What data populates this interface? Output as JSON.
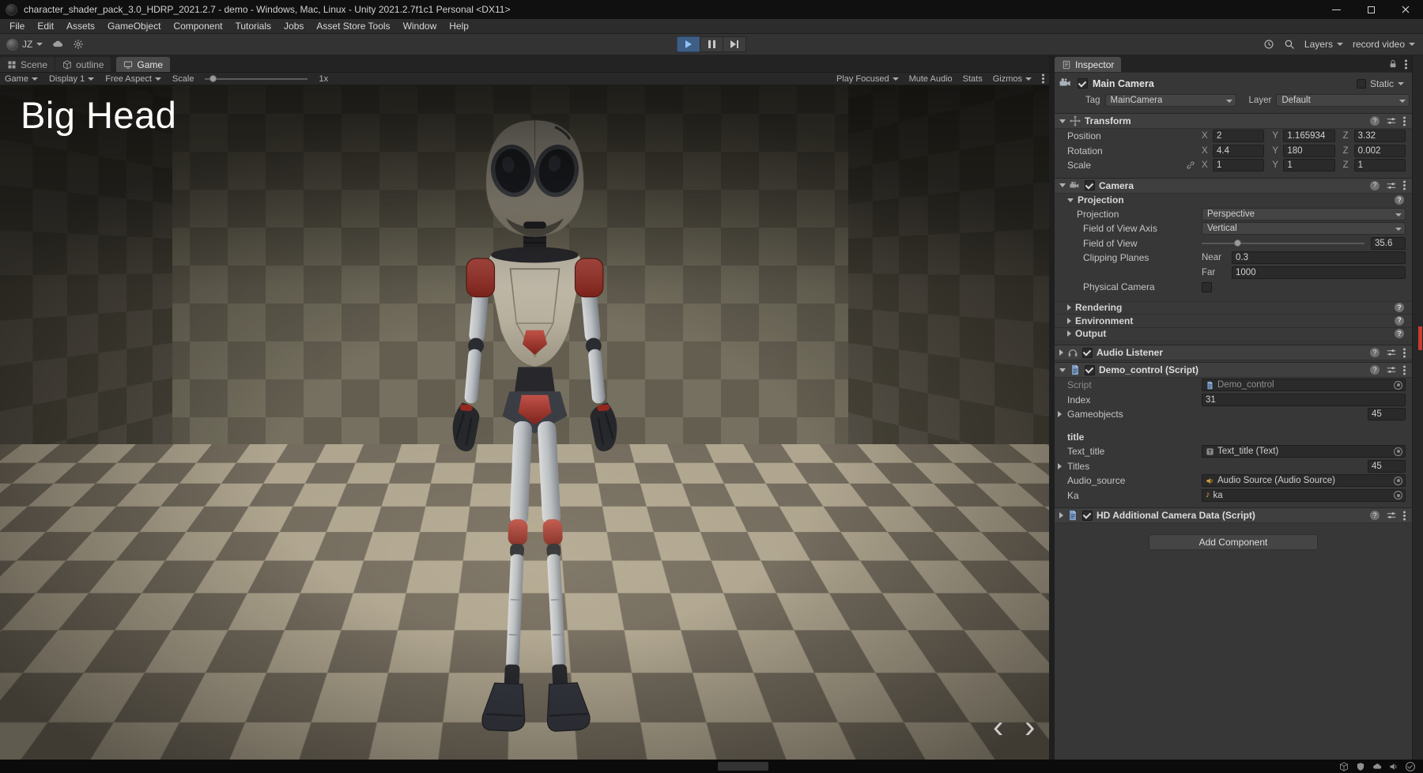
{
  "title_bar": {
    "title": "character_shader_pack_3.0_HDRP_2021.2.7 - demo - Windows, Mac, Linux - Unity 2021.2.7f1c1 Personal <DX11>"
  },
  "menu": {
    "file": "File",
    "edit": "Edit",
    "assets": "Assets",
    "gameobject": "GameObject",
    "component": "Component",
    "tutorials": "Tutorials",
    "jobs": "Jobs",
    "asset_store_tools": "Asset Store Tools",
    "window": "Window",
    "help": "Help"
  },
  "toolbar": {
    "account": "JZ",
    "layers": "Layers",
    "layout": "record video"
  },
  "tabs": {
    "scene": "Scene",
    "outline": "outline",
    "game": "Game",
    "inspector": "Inspector"
  },
  "game_toolbar": {
    "target": "Game",
    "display": "Display 1",
    "aspect": "Free Aspect",
    "scale_label": "Scale",
    "scale_value": "1x",
    "play_focused": "Play Focused",
    "mute": "Mute Audio",
    "stats": "Stats",
    "gizmos": "Gizmos"
  },
  "game_view": {
    "overlay_title": "Big Head",
    "prev": "‹",
    "next": "›"
  },
  "inspector": {
    "header": {
      "name": "Main Camera",
      "static": "Static",
      "tag_label": "Tag",
      "tag": "MainCamera",
      "layer_label": "Layer",
      "layer": "Default"
    },
    "transform": {
      "title": "Transform",
      "axis": {
        "x": "X",
        "y": "Y",
        "z": "Z"
      },
      "position": {
        "label": "Position",
        "x": "2",
        "y": "1.165934",
        "z": "3.32"
      },
      "rotation": {
        "label": "Rotation",
        "x": "4.4",
        "y": "180",
        "z": "0.002"
      },
      "scale": {
        "label": "Scale",
        "x": "1",
        "y": "1",
        "z": "1"
      }
    },
    "camera": {
      "title": "Camera",
      "projection_header": "Projection",
      "projection_label": "Projection",
      "projection": "Perspective",
      "fov_axis_label": "Field of View Axis",
      "fov_axis": "Vertical",
      "fov_label": "Field of View",
      "fov": "35.6",
      "clipping_label": "Clipping Planes",
      "near_label": "Near",
      "near": "0.3",
      "far_label": "Far",
      "far": "1000",
      "physical_label": "Physical Camera",
      "rendering": "Rendering",
      "environment": "Environment",
      "output": "Output"
    },
    "audio_listener": {
      "title": "Audio Listener"
    },
    "demo_control": {
      "title": "Demo_control (Script)",
      "script_label": "Script",
      "script": "Demo_control",
      "index_label": "Index",
      "index": "31",
      "gameobjects_label": "Gameobjects",
      "gameobjects_size": "45",
      "section": "title",
      "text_title_label": "Text_title",
      "text_title": "Text_title (Text)",
      "titles_label": "Titles",
      "titles_size": "45",
      "audio_source_label": "Audio_source",
      "audio_source": "Audio Source (Audio Source)",
      "ka_label": "Ka",
      "ka": "ka"
    },
    "hd_data": {
      "title": "HD Additional Camera Data (Script)"
    },
    "add_component": "Add Component"
  },
  "icons": {
    "help": "?",
    "note": "♪"
  }
}
